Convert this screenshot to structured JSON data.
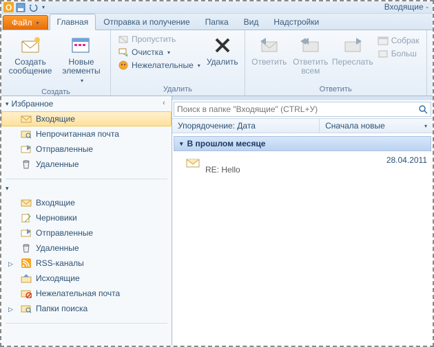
{
  "window": {
    "title": "Входящие -"
  },
  "tabs": {
    "file": "Файл",
    "home": "Главная",
    "sendreceive": "Отправка и получение",
    "folder": "Папка",
    "view": "Вид",
    "addins": "Надстройки"
  },
  "ribbon": {
    "new": {
      "label": "Создать",
      "new_mail": "Создать сообщение",
      "new_items": "Новые элементы"
    },
    "delete": {
      "label": "Удалить",
      "ignore": "Пропустить",
      "cleanup": "Очистка",
      "junk": "Нежелательные",
      "delete": "Удалить"
    },
    "respond": {
      "label": "Ответить",
      "reply": "Ответить",
      "reply_all": "Ответить всем",
      "forward": "Переслать",
      "meeting": "Собрак",
      "more": "Больш"
    }
  },
  "nav": {
    "favorites": "Избранное",
    "fav_items": [
      {
        "label": "Входящие",
        "icon": "inbox"
      },
      {
        "label": "Непрочитанная почта",
        "icon": "search-folder"
      },
      {
        "label": "Отправленные",
        "icon": "sent"
      },
      {
        "label": "Удаленные",
        "icon": "trash"
      }
    ],
    "account_items": [
      {
        "label": "Входящие",
        "icon": "inbox"
      },
      {
        "label": "Черновики",
        "icon": "drafts"
      },
      {
        "label": "Отправленные",
        "icon": "sent"
      },
      {
        "label": "Удаленные",
        "icon": "trash"
      },
      {
        "label": "RSS-каналы",
        "icon": "rss"
      },
      {
        "label": "Исходящие",
        "icon": "outbox"
      },
      {
        "label": "Нежелательная почта",
        "icon": "junk"
      },
      {
        "label": "Папки поиска",
        "icon": "search-folders"
      }
    ]
  },
  "list": {
    "search_placeholder": "Поиск в папке \"Входящие\" (CTRL+У)",
    "sort_by": "Упорядочение: Дата",
    "sort_dir": "Сначала новые",
    "group_header": "В прошлом месяце",
    "message": {
      "subject": "RE: Hello",
      "date": "28.04.2011"
    }
  }
}
